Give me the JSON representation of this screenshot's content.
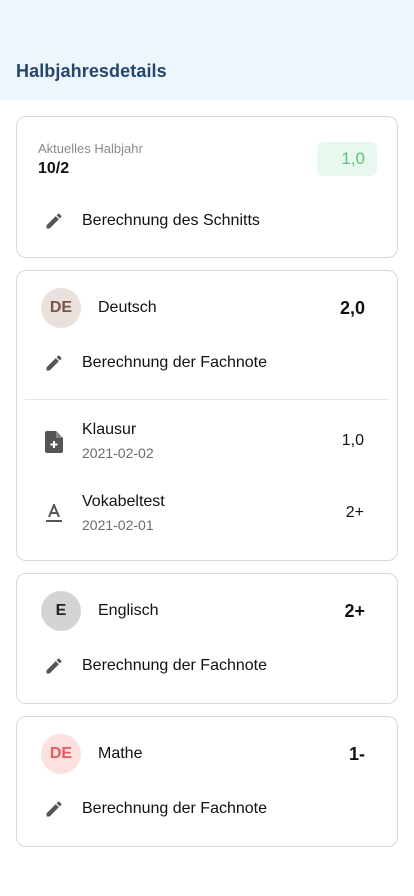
{
  "header": {
    "title": "Halbjahresdetails",
    "background": "#eef5fd",
    "title_color": "#24476b"
  },
  "semester": {
    "label": "Aktuelles Halbjahr",
    "value": "10/2",
    "average": "1,0",
    "average_color": "#5bc17f",
    "calc_label": "Berechnung des Schnitts",
    "calc_icon": "pencil-icon"
  },
  "subjects": [
    {
      "initials": "DE",
      "name": "Deutsch",
      "grade": "2,0",
      "avatar_bg": "#eae0dc",
      "avatar_fg": "#7a5548",
      "calc_label": "Berechnung der Fachnote",
      "exams": [
        {
          "title": "Klausur",
          "date": "2021-02-02",
          "grade": "1,0",
          "icon": "file-plus-icon"
        },
        {
          "title": "Vokabeltest",
          "date": "2021-02-01",
          "grade": "2+",
          "icon": "text-format-icon"
        }
      ]
    },
    {
      "initials": "E",
      "name": "Englisch",
      "grade": "2+",
      "avatar_bg": "#d4d4d4",
      "avatar_fg": "#222222",
      "calc_label": "Berechnung der Fachnote",
      "exams": []
    },
    {
      "initials": "DE",
      "name": "Mathe",
      "grade": "1-",
      "avatar_bg": "#fde0e0",
      "avatar_fg": "#e45c5c",
      "calc_label": "Berechnung der Fachnote",
      "exams": []
    }
  ]
}
